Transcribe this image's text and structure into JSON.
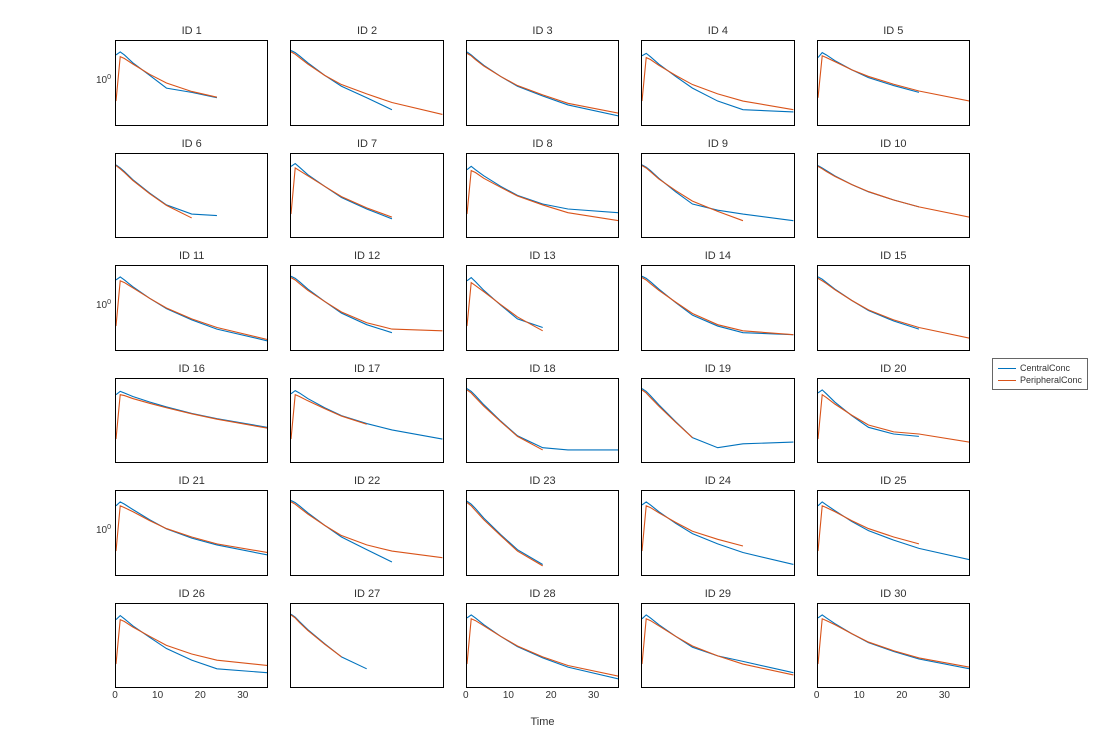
{
  "xlabel": "Time",
  "ytick_label_html": "10<sup>0</sup>",
  "ytick_value": 1,
  "xticks": [
    0,
    10,
    20,
    30
  ],
  "legend": {
    "items": [
      {
        "label": "CentralConc",
        "color": "#0072BD"
      },
      {
        "label": "PeripheralConc",
        "color": "#D95319"
      }
    ]
  },
  "chart_data": {
    "type": "line",
    "xlim": [
      0,
      36
    ],
    "x": [
      0,
      1,
      2,
      4,
      8,
      12,
      18,
      24,
      36
    ],
    "yscale": "log",
    "ylim": [
      0.1,
      5
    ],
    "xlabel": "Time",
    "series_names": [
      "CentralConc",
      "PeripheralConc"
    ],
    "subplots": [
      {
        "title": "ID 1",
        "series": [
          {
            "name": "CentralConc",
            "y": [
              2.6,
              3.0,
              2.6,
              1.8,
              1.0,
              0.55,
              0.45,
              0.35,
              null
            ]
          },
          {
            "name": "PeripheralConc",
            "y": [
              0.3,
              2.4,
              2.2,
              1.7,
              1.05,
              0.7,
              0.47,
              0.36,
              null
            ]
          }
        ]
      },
      {
        "title": "ID 2",
        "series": [
          {
            "name": "CentralConc",
            "y": [
              3.2,
              2.9,
              2.5,
              1.8,
              1.0,
              0.6,
              0.35,
              0.2,
              null
            ]
          },
          {
            "name": "PeripheralConc",
            "y": [
              3.0,
              2.7,
              2.3,
              1.7,
              1.0,
              0.65,
              0.42,
              0.28,
              0.16
            ]
          }
        ]
      },
      {
        "title": "ID 3",
        "series": [
          {
            "name": "CentralConc",
            "y": [
              3.0,
              2.6,
              2.2,
              1.6,
              0.95,
              0.6,
              0.38,
              0.25,
              0.15
            ]
          },
          {
            "name": "PeripheralConc",
            "y": [
              2.8,
              2.5,
              2.1,
              1.55,
              0.95,
              0.62,
              0.4,
              0.27,
              0.17
            ]
          }
        ]
      },
      {
        "title": "ID 4",
        "series": [
          {
            "name": "CentralConc",
            "y": [
              2.5,
              2.8,
              2.4,
              1.7,
              0.95,
              0.55,
              0.3,
              0.2,
              0.18
            ]
          },
          {
            "name": "PeripheralConc",
            "y": [
              0.3,
              2.3,
              2.1,
              1.6,
              1.0,
              0.65,
              0.42,
              0.3,
              0.2
            ]
          }
        ]
      },
      {
        "title": "ID 5",
        "series": [
          {
            "name": "CentralConc",
            "y": [
              2.3,
              2.9,
              2.6,
              2.0,
              1.3,
              0.9,
              0.62,
              0.45,
              null
            ]
          },
          {
            "name": "PeripheralConc",
            "y": [
              0.35,
              2.5,
              2.3,
              1.9,
              1.3,
              0.95,
              0.66,
              0.48,
              0.3
            ]
          }
        ]
      },
      {
        "title": "ID 6",
        "series": [
          {
            "name": "CentralConc",
            "y": [
              3.0,
              2.6,
              2.2,
              1.5,
              0.8,
              0.46,
              0.3,
              0.28,
              null
            ]
          },
          {
            "name": "PeripheralConc",
            "y": [
              2.9,
              2.5,
              2.1,
              1.45,
              0.78,
              0.45,
              0.25,
              null,
              null
            ]
          }
        ]
      },
      {
        "title": "ID 7",
        "series": [
          {
            "name": "CentralConc",
            "y": [
              2.8,
              3.2,
              2.7,
              1.9,
              1.1,
              0.65,
              0.38,
              0.24,
              null
            ]
          },
          {
            "name": "PeripheralConc",
            "y": [
              0.3,
              2.6,
              2.3,
              1.8,
              1.1,
              0.68,
              0.4,
              0.26,
              null
            ]
          }
        ]
      },
      {
        "title": "ID 8",
        "series": [
          {
            "name": "CentralConc",
            "y": [
              2.4,
              2.8,
              2.4,
              1.8,
              1.1,
              0.72,
              0.48,
              0.38,
              0.32
            ]
          },
          {
            "name": "PeripheralConc",
            "y": [
              0.3,
              2.3,
              2.1,
              1.6,
              1.05,
              0.7,
              0.46,
              0.32,
              0.22
            ]
          }
        ]
      },
      {
        "title": "ID 9",
        "series": [
          {
            "name": "CentralConc",
            "y": [
              3.0,
              2.7,
              2.3,
              1.6,
              0.85,
              0.48,
              0.36,
              0.3,
              0.22
            ]
          },
          {
            "name": "PeripheralConc",
            "y": [
              2.9,
              2.6,
              2.2,
              1.55,
              0.9,
              0.55,
              0.34,
              0.22,
              null
            ]
          }
        ]
      },
      {
        "title": "ID 10",
        "series": [
          {
            "name": "CentralConc",
            "y": [
              2.9,
              2.6,
              2.3,
              1.8,
              1.2,
              0.85,
              0.58,
              0.42,
              null
            ]
          },
          {
            "name": "PeripheralConc",
            "y": [
              2.8,
              2.5,
              2.2,
              1.75,
              1.2,
              0.86,
              0.58,
              0.42,
              0.26
            ]
          }
        ]
      },
      {
        "title": "ID 11",
        "series": [
          {
            "name": "CentralConc",
            "y": [
              2.6,
              3.0,
              2.6,
              1.9,
              1.1,
              0.68,
              0.4,
              0.26,
              0.15
            ]
          },
          {
            "name": "PeripheralConc",
            "y": [
              0.3,
              2.5,
              2.3,
              1.8,
              1.1,
              0.7,
              0.42,
              0.28,
              0.16
            ]
          }
        ]
      },
      {
        "title": "ID 12",
        "series": [
          {
            "name": "CentralConc",
            "y": [
              3.1,
              2.8,
              2.4,
              1.7,
              0.95,
              0.55,
              0.32,
              0.22,
              null
            ]
          },
          {
            "name": "PeripheralConc",
            "y": [
              2.9,
              2.6,
              2.2,
              1.6,
              0.95,
              0.58,
              0.35,
              0.26,
              0.24
            ]
          }
        ]
      },
      {
        "title": "ID 13",
        "series": [
          {
            "name": "CentralConc",
            "y": [
              2.5,
              2.9,
              2.4,
              1.6,
              0.8,
              0.42,
              0.28,
              null,
              null
            ]
          },
          {
            "name": "PeripheralConc",
            "y": [
              0.3,
              2.3,
              2.0,
              1.5,
              0.82,
              0.46,
              0.24,
              null,
              null
            ]
          }
        ]
      },
      {
        "title": "ID 14",
        "series": [
          {
            "name": "CentralConc",
            "y": [
              3.1,
              2.8,
              2.4,
              1.7,
              0.9,
              0.5,
              0.3,
              0.22,
              0.2
            ]
          },
          {
            "name": "PeripheralConc",
            "y": [
              2.9,
              2.6,
              2.2,
              1.6,
              0.92,
              0.54,
              0.32,
              0.24,
              0.2
            ]
          }
        ]
      },
      {
        "title": "ID 15",
        "series": [
          {
            "name": "CentralConc",
            "y": [
              3.0,
              2.7,
              2.3,
              1.7,
              1.0,
              0.62,
              0.38,
              0.26,
              null
            ]
          },
          {
            "name": "PeripheralConc",
            "y": [
              2.8,
              2.5,
              2.2,
              1.65,
              1.0,
              0.64,
              0.4,
              0.28,
              0.17
            ]
          }
        ]
      },
      {
        "title": "ID 16",
        "series": [
          {
            "name": "CentralConc",
            "y": [
              2.4,
              2.8,
              2.6,
              2.2,
              1.7,
              1.35,
              1.0,
              0.78,
              0.52
            ]
          },
          {
            "name": "PeripheralConc",
            "y": [
              0.3,
              2.4,
              2.3,
              2.0,
              1.6,
              1.3,
              0.98,
              0.76,
              0.5
            ]
          }
        ]
      },
      {
        "title": "ID 17",
        "series": [
          {
            "name": "CentralConc",
            "y": [
              2.5,
              2.9,
              2.6,
              2.0,
              1.3,
              0.9,
              0.62,
              0.46,
              0.3
            ]
          },
          {
            "name": "PeripheralConc",
            "y": [
              0.3,
              2.4,
              2.2,
              1.8,
              1.25,
              0.88,
              0.6,
              null,
              null
            ]
          }
        ]
      },
      {
        "title": "ID 18",
        "series": [
          {
            "name": "CentralConc",
            "y": [
              3.2,
              2.8,
              2.3,
              1.5,
              0.7,
              0.35,
              0.2,
              0.18,
              0.18
            ]
          },
          {
            "name": "PeripheralConc",
            "y": [
              3.0,
              2.6,
              2.1,
              1.4,
              0.68,
              0.34,
              0.18,
              null,
              null
            ]
          }
        ]
      },
      {
        "title": "ID 19",
        "series": [
          {
            "name": "CentralConc",
            "y": [
              3.2,
              2.8,
              2.3,
              1.5,
              0.68,
              0.32,
              0.2,
              0.24,
              0.26
            ]
          },
          {
            "name": "PeripheralConc",
            "y": [
              3.0,
              2.6,
              2.1,
              1.4,
              0.66,
              0.32,
              null,
              null,
              null
            ]
          }
        ]
      },
      {
        "title": "ID 20",
        "series": [
          {
            "name": "CentralConc",
            "y": [
              2.6,
              3.0,
              2.5,
              1.7,
              0.9,
              0.52,
              0.38,
              0.34,
              null
            ]
          },
          {
            "name": "PeripheralConc",
            "y": [
              0.3,
              2.4,
              2.1,
              1.55,
              0.92,
              0.58,
              0.42,
              0.38,
              0.26
            ]
          }
        ]
      },
      {
        "title": "ID 21",
        "series": [
          {
            "name": "CentralConc",
            "y": [
              2.5,
              3.0,
              2.7,
              2.1,
              1.3,
              0.85,
              0.55,
              0.4,
              0.25
            ]
          },
          {
            "name": "PeripheralConc",
            "y": [
              0.3,
              2.5,
              2.3,
              1.9,
              1.25,
              0.86,
              0.58,
              0.42,
              0.28
            ]
          }
        ]
      },
      {
        "title": "ID 22",
        "series": [
          {
            "name": "CentralConc",
            "y": [
              3.2,
              2.9,
              2.5,
              1.8,
              1.0,
              0.58,
              0.32,
              0.18,
              null
            ]
          },
          {
            "name": "PeripheralConc",
            "y": [
              3.0,
              2.7,
              2.3,
              1.7,
              1.0,
              0.62,
              0.4,
              0.3,
              0.22
            ]
          }
        ]
      },
      {
        "title": "ID 23",
        "series": [
          {
            "name": "CentralConc",
            "y": [
              3.1,
              2.7,
              2.2,
              1.4,
              0.65,
              0.32,
              0.16,
              null,
              null
            ]
          },
          {
            "name": "PeripheralConc",
            "y": [
              2.9,
              2.5,
              2.0,
              1.3,
              0.62,
              0.3,
              0.15,
              null,
              null
            ]
          }
        ]
      },
      {
        "title": "ID 24",
        "series": [
          {
            "name": "CentralConc",
            "y": [
              2.6,
              3.0,
              2.6,
              1.9,
              1.1,
              0.68,
              0.42,
              0.28,
              0.16
            ]
          },
          {
            "name": "PeripheralConc",
            "y": [
              0.3,
              2.5,
              2.3,
              1.8,
              1.15,
              0.76,
              0.52,
              0.38,
              null
            ]
          }
        ]
      },
      {
        "title": "ID 25",
        "series": [
          {
            "name": "CentralConc",
            "y": [
              2.5,
              3.0,
              2.6,
              2.0,
              1.2,
              0.78,
              0.5,
              0.34,
              0.2
            ]
          },
          {
            "name": "PeripheralConc",
            "y": [
              0.3,
              2.5,
              2.3,
              1.9,
              1.25,
              0.86,
              0.58,
              0.42,
              null
            ]
          }
        ]
      },
      {
        "title": "ID 26",
        "series": [
          {
            "name": "CentralConc",
            "y": [
              2.4,
              2.9,
              2.5,
              1.8,
              1.05,
              0.62,
              0.36,
              0.24,
              0.2
            ]
          },
          {
            "name": "PeripheralConc",
            "y": [
              0.3,
              2.4,
              2.2,
              1.7,
              1.1,
              0.72,
              0.48,
              0.36,
              0.28
            ]
          }
        ]
      },
      {
        "title": "ID 27",
        "series": [
          {
            "name": "CentralConc",
            "y": [
              3.1,
              2.7,
              2.2,
              1.5,
              0.78,
              0.42,
              0.24,
              null,
              null
            ]
          },
          {
            "name": "PeripheralConc",
            "y": [
              3.0,
              2.6,
              2.1,
              1.45,
              0.76,
              0.42,
              null,
              null,
              null
            ]
          }
        ]
      },
      {
        "title": "ID 28",
        "series": [
          {
            "name": "CentralConc",
            "y": [
              2.6,
              3.0,
              2.6,
              1.9,
              1.1,
              0.68,
              0.4,
              0.26,
              0.15
            ]
          },
          {
            "name": "PeripheralConc",
            "y": [
              0.3,
              2.5,
              2.3,
              1.8,
              1.1,
              0.7,
              0.42,
              0.28,
              0.17
            ]
          }
        ]
      },
      {
        "title": "ID 29",
        "series": [
          {
            "name": "CentralConc",
            "y": [
              2.5,
              3.0,
              2.6,
              1.9,
              1.1,
              0.66,
              0.44,
              0.34,
              0.2
            ]
          },
          {
            "name": "PeripheralConc",
            "y": [
              0.3,
              2.5,
              2.3,
              1.8,
              1.1,
              0.7,
              0.44,
              0.3,
              0.18
            ]
          }
        ]
      },
      {
        "title": "ID 30",
        "series": [
          {
            "name": "CentralConc",
            "y": [
              2.6,
              3.0,
              2.6,
              2.0,
              1.25,
              0.82,
              0.54,
              0.38,
              0.24
            ]
          },
          {
            "name": "PeripheralConc",
            "y": [
              0.3,
              2.5,
              2.3,
              1.9,
              1.25,
              0.84,
              0.56,
              0.4,
              0.26
            ]
          }
        ]
      }
    ]
  }
}
